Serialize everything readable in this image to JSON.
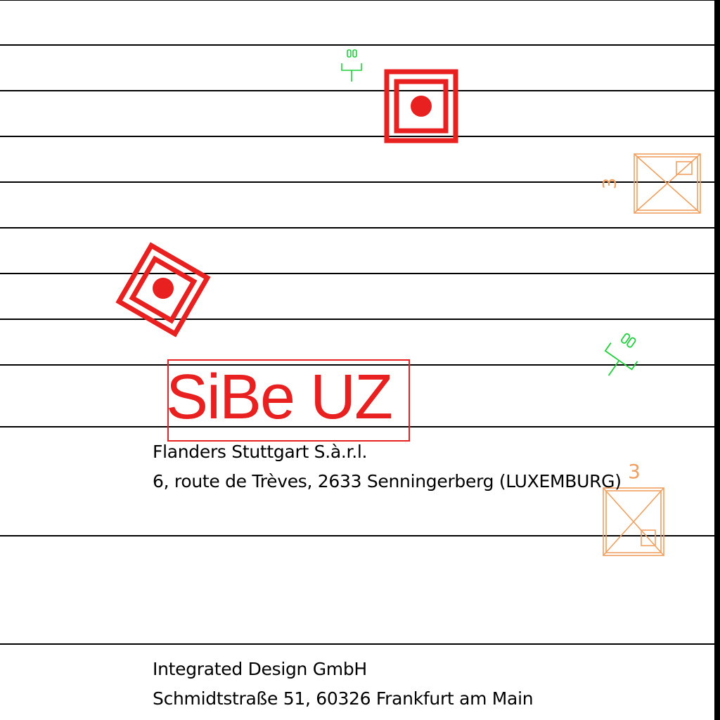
{
  "drawing": {
    "stamp_label": "SiBe UZ",
    "client": {
      "company": "Flanders Stuttgart S.à.r.l.",
      "address": "6, route de Trèves,  2633 Senningerberg (LUXEMBURG)"
    },
    "designer": {
      "company": "Integrated Design GmbH",
      "address": "Schmidtstraße 51,  60326 Frankfurt am Main"
    },
    "box_symbol_upper_number": "3",
    "box_symbol_lower_number": "3",
    "colors": {
      "lines": "#000000",
      "target_symbol": "#e82020",
      "stamp": "#e82020",
      "green_symbol": "#1ed03a",
      "box_symbol": "#f0a060"
    },
    "icons": [
      "target-square-icon",
      "crossed-box-icon",
      "green-fixture-icon"
    ]
  }
}
